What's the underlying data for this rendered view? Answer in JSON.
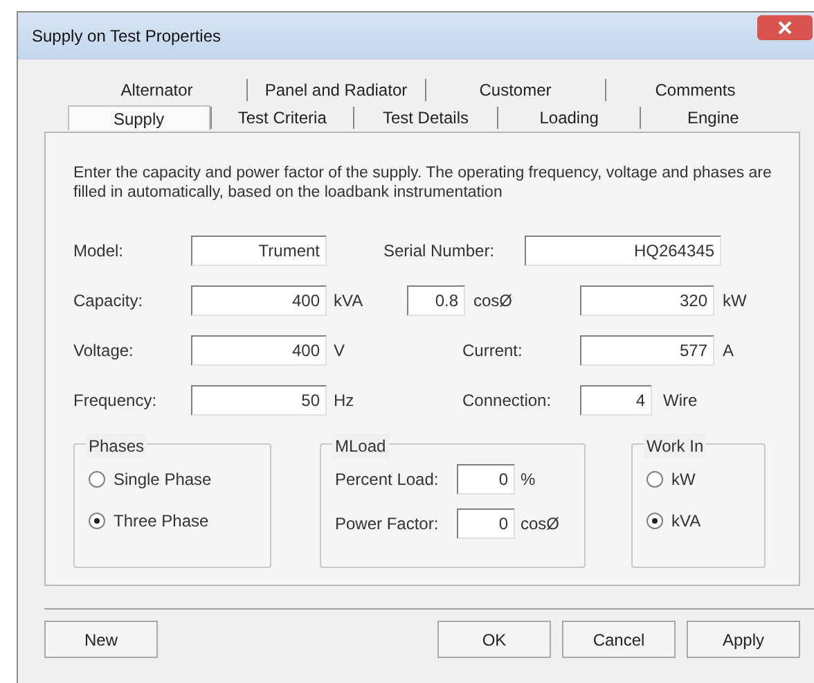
{
  "window": {
    "title": "Supply on Test Properties"
  },
  "tab_rows": [
    {
      "tabs": [
        {
          "label": "Alternator",
          "selected": false
        },
        {
          "label": "Panel and Radiator",
          "selected": false
        },
        {
          "label": "Customer",
          "selected": false
        },
        {
          "label": "Comments",
          "selected": false
        }
      ]
    },
    {
      "tabs": [
        {
          "label": "Supply",
          "selected": true
        },
        {
          "label": "Test Criteria",
          "selected": false
        },
        {
          "label": "Test Details",
          "selected": false
        },
        {
          "label": "Loading",
          "selected": false
        },
        {
          "label": "Engine",
          "selected": false
        }
      ]
    }
  ],
  "description": "Enter the capacity and power factor of the supply. The operating frequency, voltage and phases are filled in automatically, based on the loadbank instrumentation",
  "model": {
    "label": "Model:",
    "value": "Trument"
  },
  "serial_number": {
    "label": "Serial Number:",
    "value": "HQ264345"
  },
  "capacity": {
    "label": "Capacity:",
    "value": "400",
    "unit": "kVA"
  },
  "power_factor": {
    "value": "0.8",
    "unit": "cosØ"
  },
  "power": {
    "value": "320",
    "unit": "kW"
  },
  "voltage": {
    "label": "Voltage:",
    "value": "400",
    "unit": "V"
  },
  "current": {
    "label": "Current:",
    "value": "577",
    "unit": "A"
  },
  "frequency": {
    "label": "Frequency:",
    "value": "50",
    "unit": "Hz"
  },
  "connection": {
    "label": "Connection:",
    "value": "4",
    "unit": "Wire"
  },
  "phases": {
    "title": "Phases",
    "options": [
      {
        "label": "Single Phase",
        "selected": false
      },
      {
        "label": "Three Phase",
        "selected": true
      }
    ]
  },
  "mload": {
    "title": "MLoad",
    "rows": [
      {
        "label": "Percent Load:",
        "value": "0",
        "unit": "%"
      },
      {
        "label": "Power Factor:",
        "value": "0",
        "unit": "cosØ"
      }
    ]
  },
  "work_in": {
    "title": "Work In",
    "options": [
      {
        "label": "kW",
        "selected": false
      },
      {
        "label": "kVA",
        "selected": true
      }
    ]
  },
  "buttons": [
    "New",
    "OK",
    "Cancel",
    "Apply"
  ]
}
